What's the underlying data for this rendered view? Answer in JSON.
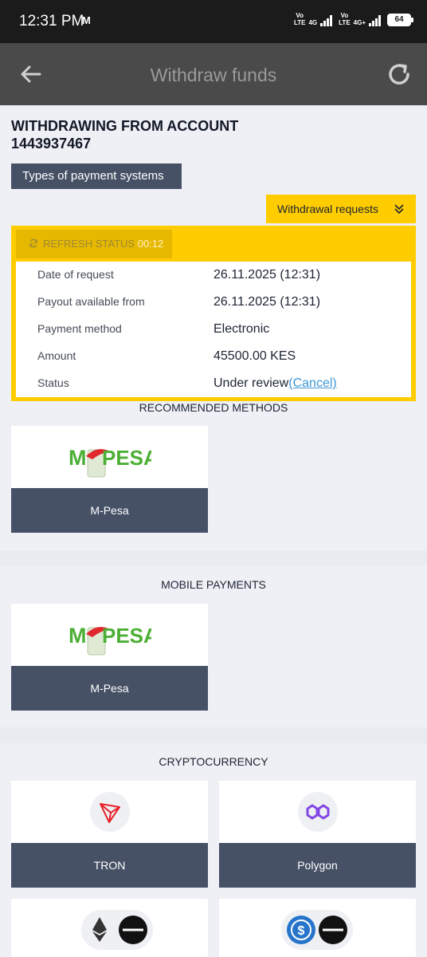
{
  "status_bar": {
    "time": "12:31 PM",
    "mail": "M",
    "net1_top": "Vo",
    "net1_bottom": "LTE",
    "net1_gen": "4G",
    "net2_top": "Vo",
    "net2_bottom": "LTE",
    "net2_gen": "4G+",
    "battery": "64"
  },
  "appbar": {
    "title": "Withdraw funds"
  },
  "account": {
    "heading_line1": "WITHDRAWING FROM ACCOUNT",
    "heading_line2": "1443937467"
  },
  "types_button": "Types of payment systems",
  "withdrawal_requests_button": "Withdrawal requests",
  "request": {
    "refresh_label": "REFRESH STATUS",
    "refresh_timer": "00:12",
    "rows": [
      {
        "label": "Date of request",
        "value": "26.11.2025 (12:31)"
      },
      {
        "label": "Payout available from",
        "value": "26.11.2025 (12:31)"
      },
      {
        "label": "Payment method",
        "value": "Electronic"
      },
      {
        "label": "Amount",
        "value": "45500.00 KES"
      },
      {
        "label": "Status",
        "value": "Under review"
      }
    ],
    "cancel_label": "(Cancel)"
  },
  "sections": {
    "recommended": {
      "title": "RECOMMENDED METHODS",
      "cards": [
        {
          "label": "M-Pesa",
          "logo": "M-PESA"
        }
      ]
    },
    "mobile": {
      "title": "MOBILE PAYMENTS",
      "cards": [
        {
          "label": "M-Pesa",
          "logo": "M-PESA"
        }
      ]
    },
    "crypto": {
      "title": "CRYPTOCURRENCY",
      "cards": [
        {
          "label": "TRON",
          "icon": "tron-icon"
        },
        {
          "label": "Polygon",
          "icon": "polygon-icon"
        }
      ]
    }
  },
  "colors": {
    "accent": "#ffcc00",
    "button_dark": "#465166",
    "appbar": "#4a4a4a",
    "link": "#3d97d6",
    "mpesa_green": "#4caf35",
    "mpesa_red": "#e0282e"
  }
}
